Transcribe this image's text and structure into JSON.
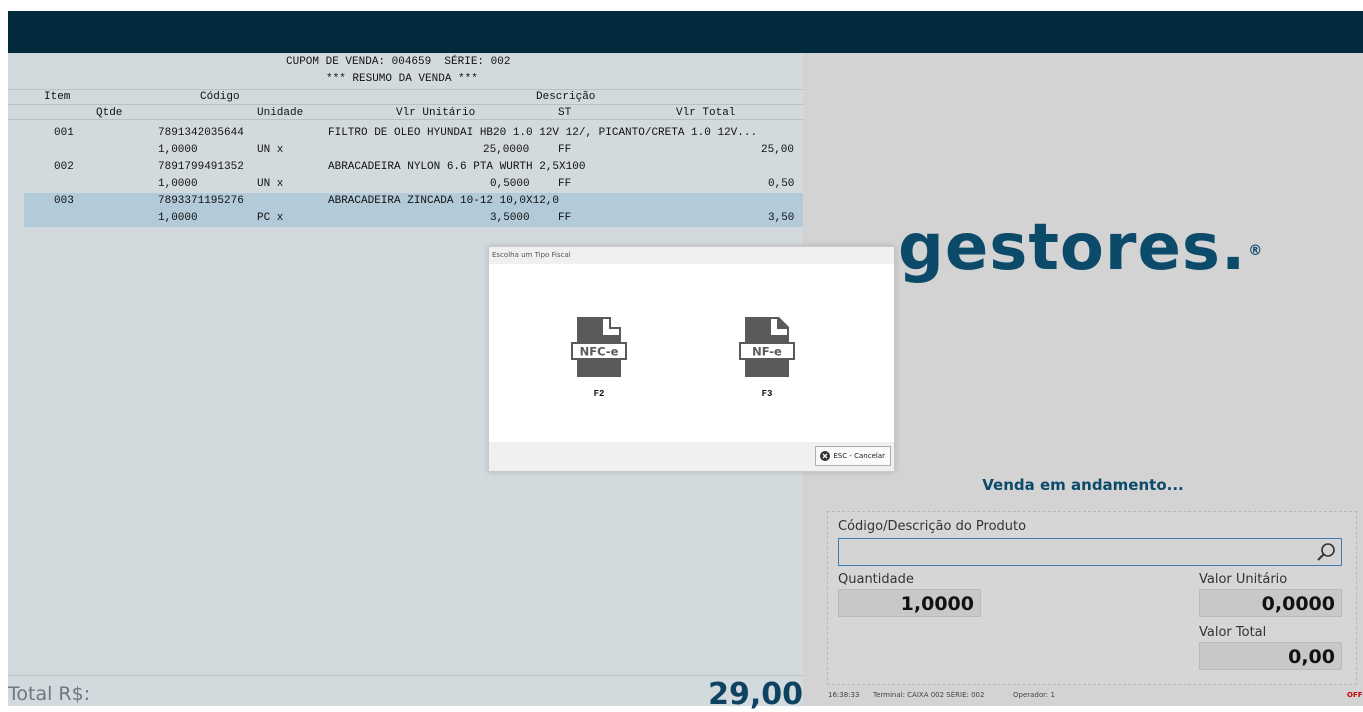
{
  "receipt": {
    "title_line": "CUPOM DE VENDA: 004659  SÉRIE: 002",
    "subtitle_line": "*** RESUMO DA VENDA ***",
    "headers1": {
      "item": "Item",
      "codigo": "Código",
      "descricao": "Descrição"
    },
    "headers2": {
      "qtde": "Qtde",
      "unidade": "Unidade",
      "vlr_unitario": "Vlr Unitário",
      "st": "ST",
      "vlr_total": "Vlr Total"
    },
    "items": [
      {
        "item": "001",
        "codigo": "7891342035644",
        "descricao": "FILTRO DE OLEO HYUNDAI HB20 1.0 12V 12/, PICANTO/CRETA 1.0 12V...",
        "qtde": "1,0000",
        "unidade": "UN x",
        "vlr_unitario": "25,0000",
        "st": "FF",
        "vlr_total": "25,00"
      },
      {
        "item": "002",
        "codigo": "7891799491352",
        "descricao": "ABRACADEIRA NYLON 6.6 PTA WURTH 2,5X100",
        "qtde": "1,0000",
        "unidade": "UN x",
        "vlr_unitario": "0,5000",
        "st": "FF",
        "vlr_total": "0,50"
      },
      {
        "item": "003",
        "codigo": "7893371195276",
        "descricao": "ABRACADEIRA ZINCADA 10-12 10,0X12,0",
        "qtde": "1,0000",
        "unidade": "PC x",
        "vlr_unitario": "3,5000",
        "st": "FF",
        "vlr_total": "3,50"
      }
    ]
  },
  "total": {
    "label": "Total R$:",
    "value": "29,00"
  },
  "brand": {
    "logo_text": "gestores.",
    "reg": "®"
  },
  "status": "Venda em andamento...",
  "form": {
    "produto_label": "Código/Descrição do Produto",
    "produto_value": "",
    "quantidade_label": "Quantidade",
    "quantidade_value": "1,0000",
    "valor_unitario_label": "Valor Unitário",
    "valor_unitario_value": "0,0000",
    "valor_total_label": "Valor Total",
    "valor_total_value": "0,00"
  },
  "footer": {
    "time": "16:38:33",
    "terminal": "Terminal: CAIXA 002  SÉRIE: 002",
    "operador": "Operador: 1",
    "status": "OFF"
  },
  "modal": {
    "title": "Escolha um Tipo Fiscal",
    "options": [
      {
        "doc": "NFC-e",
        "key": "F2"
      },
      {
        "doc": "NF-e",
        "key": "F3"
      }
    ],
    "cancel_label": "ESC - Cancelar"
  },
  "colors": {
    "topbar": "#012b3d",
    "brand": "#0c4a6a",
    "highlight_row": "#b3cbd9",
    "off_status": "#cc0000"
  }
}
